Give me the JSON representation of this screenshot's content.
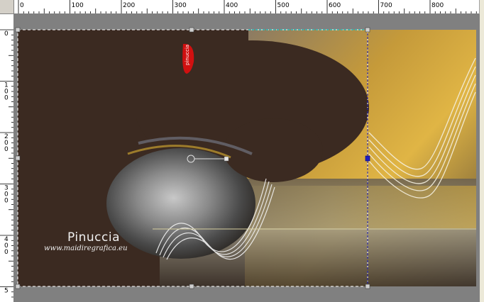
{
  "ruler": {
    "h_labels": [
      "0",
      "100",
      "200",
      "300",
      "400",
      "500",
      "600",
      "700",
      "800"
    ],
    "v_labels": [
      "0",
      "1\n0\n0",
      "2\n0\n0",
      "3\n0\n0",
      "4\n0\n0",
      "5"
    ]
  },
  "canvas": {
    "watermark_name": "Pinuccia",
    "watermark_url": "www.maidiregrafica.eu",
    "tube_signature": "pinuccia"
  },
  "colors": {
    "background_brown": "#3b2a21",
    "gold": "#d4a437",
    "workspace_gray": "#808080",
    "selection_cyan": "#00e0e0",
    "handle_blue": "#2020c0"
  },
  "icons": {
    "transform_handle": "rotation-handle-icon",
    "signature_tag": "red-tag-icon"
  }
}
